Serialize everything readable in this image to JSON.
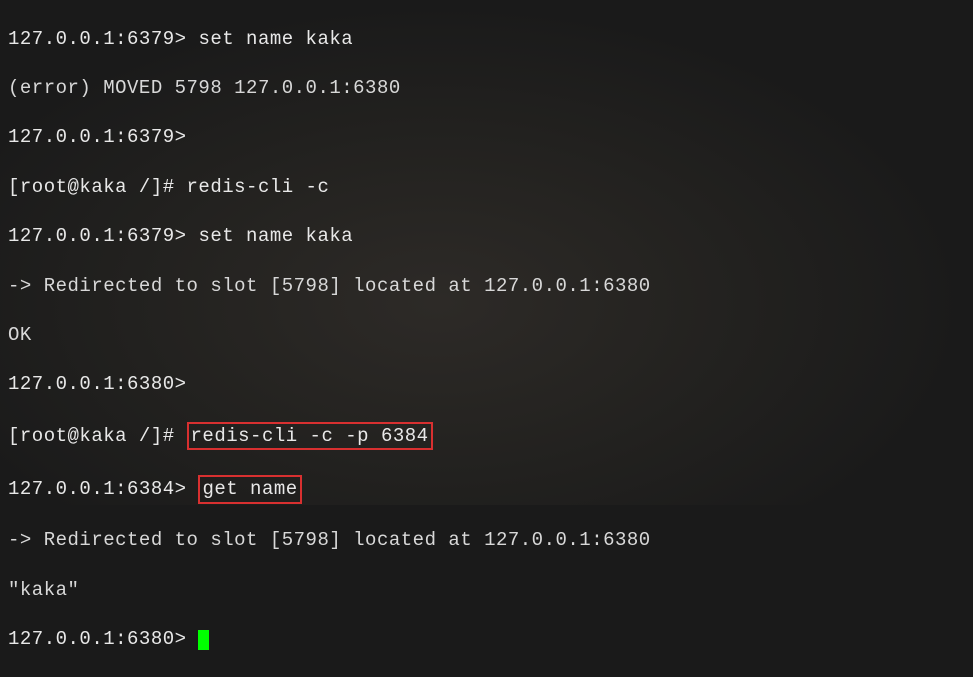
{
  "lines": {
    "l1_prompt": "127.0.0.1:6379> ",
    "l1_cmd": "set name kaka",
    "l2": "(error) MOVED 5798 127.0.0.1:6380",
    "l3": "127.0.0.1:6379>",
    "l4_prompt": "[root@kaka /]# ",
    "l4_cmd": "redis-cli -c",
    "l5_prompt": "127.0.0.1:6379> ",
    "l5_cmd": "set name kaka",
    "l6": "-> Redirected to slot [5798] located at 127.0.0.1:6380",
    "l7": "OK",
    "l8": "127.0.0.1:6380>",
    "l9_prompt": "[root@kaka /]# ",
    "l9_cmd": "redis-cli -c -p 6384",
    "l10_prompt": "127.0.0.1:6384> ",
    "l10_cmd": "get name",
    "l11": "-> Redirected to slot [5798] located at 127.0.0.1:6380",
    "l12": "\"kaka\"",
    "l13": "127.0.0.1:6380> "
  }
}
